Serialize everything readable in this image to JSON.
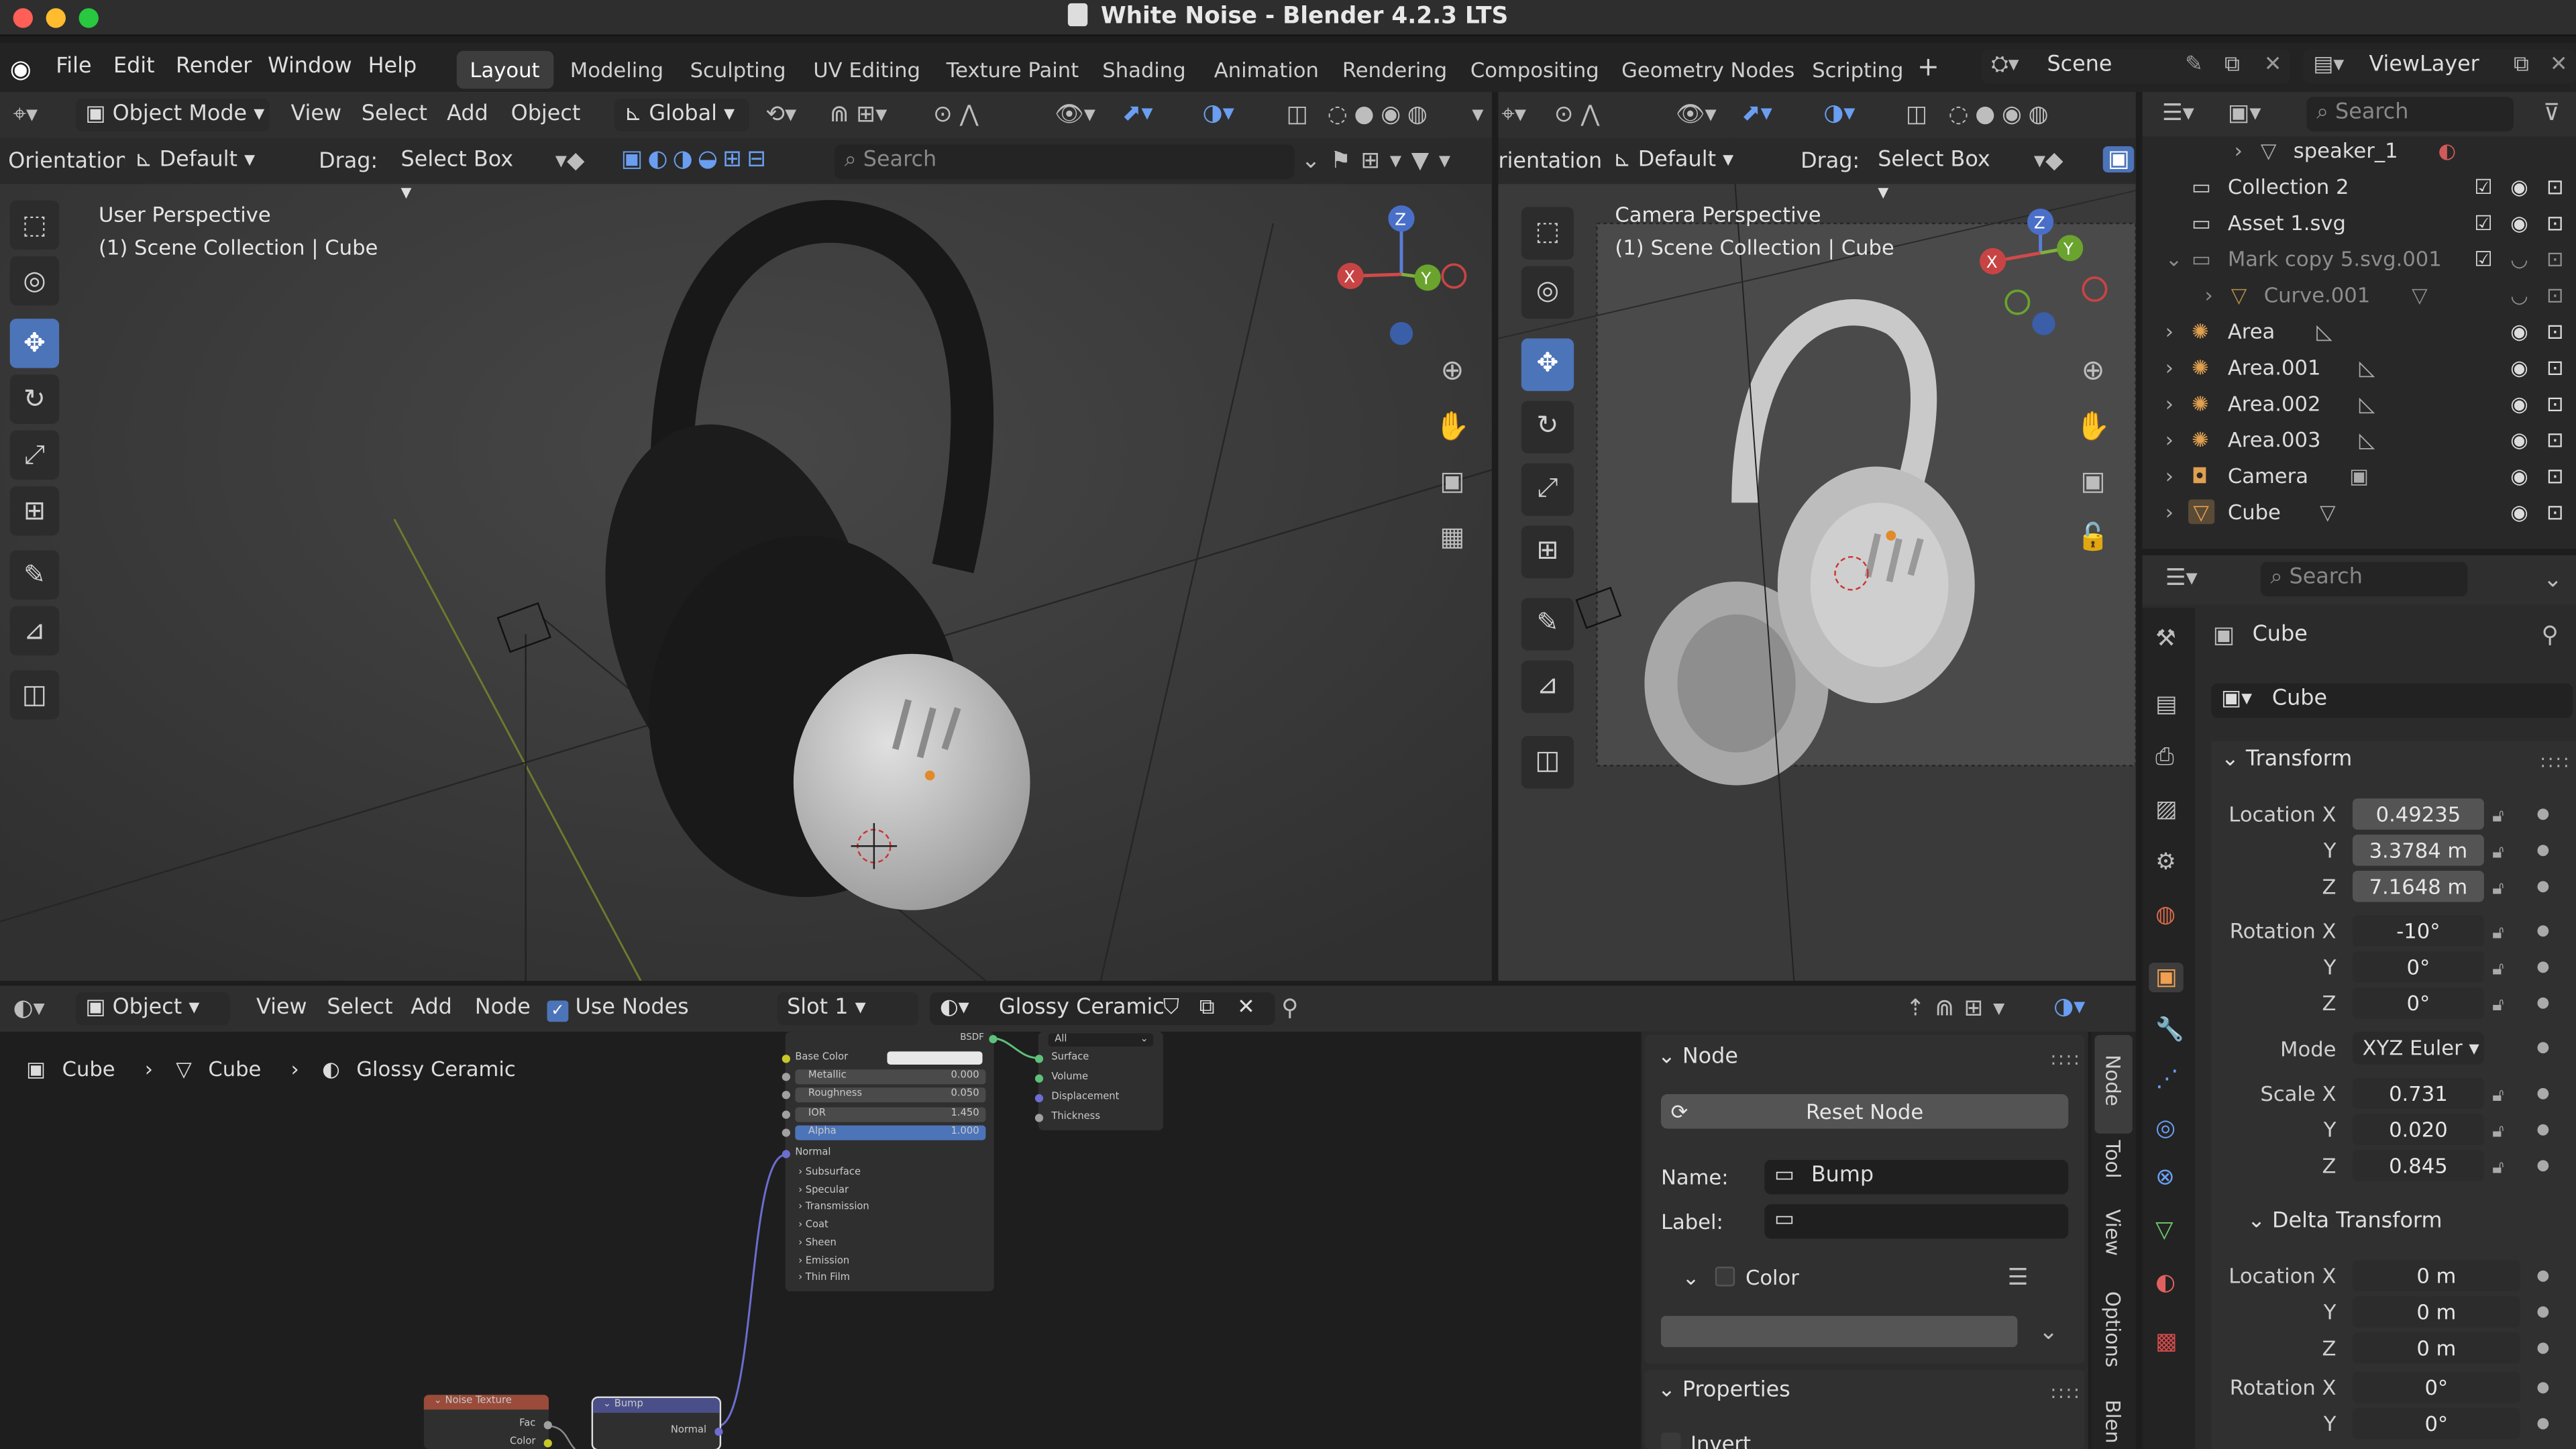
{
  "window": {
    "title": "White Noise - Blender 4.2.3 LTS"
  },
  "menu": [
    "File",
    "Edit",
    "Render",
    "Window",
    "Help"
  ],
  "workspaces": [
    "Layout",
    "Modeling",
    "Sculpting",
    "UV Editing",
    "Texture Paint",
    "Shading",
    "Animation",
    "Rendering",
    "Compositing",
    "Geometry Nodes",
    "Scripting"
  ],
  "scene": "Scene",
  "view_layer": "ViewLayer",
  "viewport_left": {
    "mode": "Object Mode",
    "menus": [
      "View",
      "Select",
      "Add",
      "Object"
    ],
    "transform": "Global",
    "orientation_label": "Orientation:",
    "orientation": "Default",
    "drag_label": "Drag:",
    "drag": "Select Box",
    "search_placeholder": "Search",
    "perspective": "User Perspective",
    "collection": "(1) Scene Collection | Cube"
  },
  "viewport_right": {
    "orientation_label": "rientation:",
    "orientation": "Default",
    "drag_label": "Drag:",
    "drag": "Select Box",
    "perspective": "Camera Perspective",
    "collection": "(1) Scene Collection | Cube"
  },
  "outliner": {
    "search_placeholder": "Search",
    "items": [
      {
        "label": "speaker_1"
      },
      {
        "label": "Collection 2"
      },
      {
        "label": "Asset 1.svg"
      },
      {
        "label": "Mark copy 5.svg.001"
      },
      {
        "label": "Curve.001"
      },
      {
        "label": "Area"
      },
      {
        "label": "Area.001"
      },
      {
        "label": "Area.002"
      },
      {
        "label": "Area.003"
      },
      {
        "label": "Camera"
      },
      {
        "label": "Cube"
      }
    ]
  },
  "properties": {
    "search_placeholder": "Search",
    "object_name": "Cube",
    "object_field": "Cube",
    "transform_label": "Transform",
    "location_label": "Location X",
    "y_label": "Y",
    "z_label": "Z",
    "location": [
      "0.49235",
      "3.3784 m",
      "7.1648 m"
    ],
    "rotation_label": "Rotation X",
    "rotation": [
      "-10°",
      "0°",
      "0°"
    ],
    "mode_label": "Mode",
    "mode": "XYZ Euler",
    "scale_label": "Scale X",
    "scale": [
      "0.731",
      "0.020",
      "0.845"
    ],
    "delta_label": "Delta Transform",
    "delta_location": [
      "0 m",
      "0 m",
      "0 m"
    ],
    "delta_rotation": [
      "0°",
      "0°"
    ]
  },
  "node_editor": {
    "type": "Object",
    "menus": [
      "View",
      "Select",
      "Add",
      "Node"
    ],
    "use_nodes": "Use Nodes",
    "slot": "Slot 1",
    "material": "Glossy Ceramic",
    "breadcrumb": [
      "Cube",
      "Cube",
      "Glossy Ceramic"
    ],
    "bsdf": {
      "header": "BSDF",
      "rows": [
        {
          "label": "Base Color",
          "value": ""
        },
        {
          "label": "Metallic",
          "value": "0.000"
        },
        {
          "label": "Roughness",
          "value": "0.050"
        },
        {
          "label": "IOR",
          "value": "1.450"
        },
        {
          "label": "Alpha",
          "value": "1.000"
        }
      ],
      "normal": "Normal",
      "panels": [
        "Subsurface",
        "Specular",
        "Transmission",
        "Coat",
        "Sheen",
        "Emission",
        "Thin Film"
      ]
    },
    "output": {
      "target": "All",
      "sockets": [
        "Surface",
        "Volume",
        "Displacement",
        "Thickness"
      ]
    },
    "noise": {
      "title": "Noise Texture",
      "sockets": [
        "Fac",
        "Color"
      ]
    },
    "bump": {
      "title": "Bump",
      "socket": "Normal"
    }
  },
  "node_panel": {
    "section": "Node",
    "reset": "Reset Node",
    "name_label": "Name:",
    "name": "Bump",
    "label_label": "Label:",
    "label": "",
    "color_label": "Color",
    "properties_label": "Properties",
    "invert_label": "Invert",
    "tabs": [
      "Node",
      "Tool",
      "View",
      "Options",
      "Blen"
    ]
  }
}
